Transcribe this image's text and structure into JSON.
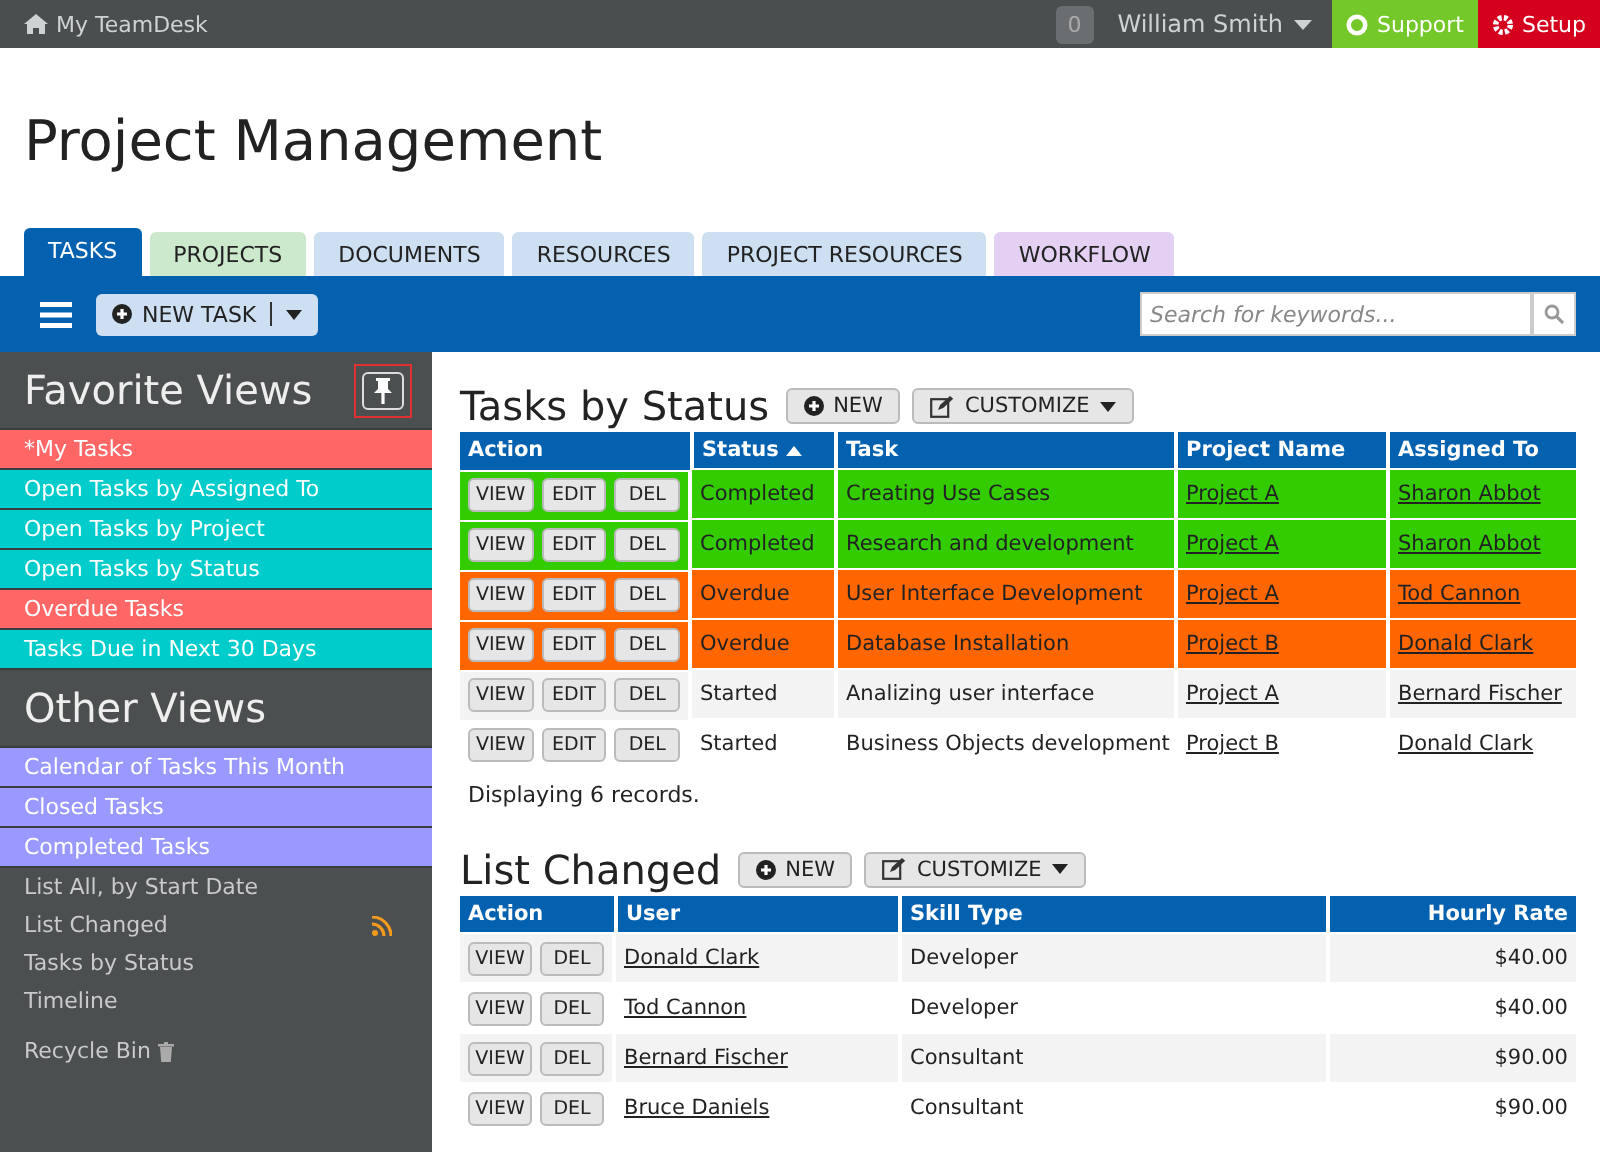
{
  "topbar": {
    "home": "My TeamDesk",
    "count": "0",
    "user": "William Smith",
    "support": "Support",
    "setup": "Setup"
  },
  "page_title": "Project Management",
  "tabs": [
    {
      "label": "TASKS",
      "selected": true,
      "color": "#0461b0"
    },
    {
      "label": "PROJECTS",
      "selected": false,
      "color": "#cde9cd"
    },
    {
      "label": "DOCUMENTS",
      "selected": false,
      "color": "#cddff0"
    },
    {
      "label": "RESOURCES",
      "selected": false,
      "color": "#cddff0"
    },
    {
      "label": "PROJECT RESOURCES",
      "selected": false,
      "color": "#cddff0"
    },
    {
      "label": "WORKFLOW",
      "selected": false,
      "color": "#e3d0f2"
    }
  ],
  "toolbar": {
    "new_task": "NEW TASK",
    "search": {
      "placeholder": "Search for keywords..."
    }
  },
  "sidebar": {
    "favorites_title": "Favorite Views",
    "favorites": [
      {
        "label": "*My Tasks",
        "color": "#ff6666"
      },
      {
        "label": "Open Tasks by Assigned To",
        "color": "#00cccc"
      },
      {
        "label": "Open Tasks by Project",
        "color": "#00cccc"
      },
      {
        "label": "Open Tasks by Status",
        "color": "#00cccc"
      },
      {
        "label": "Overdue Tasks",
        "color": "#ff6666"
      },
      {
        "label": "Tasks Due in Next 30 Days",
        "color": "#00cccc"
      }
    ],
    "other_title": "Other Views",
    "other": [
      {
        "label": "Calendar of Tasks This Month",
        "kind": "highlight",
        "color": "#9999ff"
      },
      {
        "label": "Closed Tasks",
        "kind": "highlight",
        "color": "#9999ff"
      },
      {
        "label": "Completed Tasks",
        "kind": "highlight",
        "color": "#9999ff"
      },
      {
        "label": "List All, by Start Date",
        "kind": "plain"
      },
      {
        "label": "List Changed",
        "kind": "feed"
      },
      {
        "label": "Tasks by Status",
        "kind": "plain"
      },
      {
        "label": "Timeline",
        "kind": "plain"
      }
    ],
    "recycle_bin": "Recycle Bin"
  },
  "sections": [
    {
      "title": "Tasks by Status",
      "new": "NEW",
      "customize": "CUSTOMIZE",
      "action_column": "Action",
      "columns": [
        {
          "label": "Status",
          "kind": "text",
          "sorted": true
        },
        {
          "label": "Task",
          "kind": "text",
          "sorted": false
        },
        {
          "label": "Project Name",
          "kind": "link",
          "sorted": false
        },
        {
          "label": "Assigned To",
          "kind": "link",
          "sorted": false
        }
      ],
      "rows": [
        {
          "color": "#33cc00",
          "actions": [
            "VIEW",
            "EDIT",
            "DEL"
          ],
          "cells": [
            "Completed",
            "Creating Use Cases",
            "Project A",
            "Sharon Abbot"
          ]
        },
        {
          "color": "#33cc00",
          "actions": [
            "VIEW",
            "EDIT",
            "DEL"
          ],
          "cells": [
            "Completed",
            "Research and development",
            "Project A",
            "Sharon Abbot"
          ]
        },
        {
          "color": "#ff6600",
          "actions": [
            "VIEW",
            "EDIT",
            "DEL"
          ],
          "cells": [
            "Overdue",
            "User Interface Development",
            "Project A",
            "Tod Cannon"
          ]
        },
        {
          "color": "#ff6600",
          "actions": [
            "VIEW",
            "EDIT",
            "DEL"
          ],
          "cells": [
            "Overdue",
            "Database Installation",
            "Project B",
            "Donald Clark"
          ]
        },
        {
          "actions": [
            "VIEW",
            "EDIT",
            "DEL"
          ],
          "cells": [
            "Started",
            "Analizing user interface",
            "Project A",
            "Bernard Fischer"
          ]
        },
        {
          "actions": [
            "VIEW",
            "EDIT",
            "DEL"
          ],
          "cells": [
            "Started",
            "Business Objects development",
            "Project B",
            "Donald Clark"
          ]
        }
      ],
      "footer": "Displaying 6 records."
    },
    {
      "title": "List Changed",
      "new": "NEW",
      "customize": "CUSTOMIZE",
      "action_column": "Action",
      "columns": [
        {
          "label": "User",
          "kind": "link",
          "sorted": false
        },
        {
          "label": "Skill Type",
          "kind": "text",
          "sorted": false
        },
        {
          "label": "Hourly Rate",
          "kind": "number",
          "sorted": false
        }
      ],
      "rows": [
        {
          "actions": [
            "VIEW",
            "DEL"
          ],
          "cells": [
            "Donald Clark",
            "Developer",
            "$40.00"
          ]
        },
        {
          "actions": [
            "VIEW",
            "DEL"
          ],
          "cells": [
            "Tod Cannon",
            "Developer",
            "$40.00"
          ]
        },
        {
          "actions": [
            "VIEW",
            "DEL"
          ],
          "cells": [
            "Bernard Fischer",
            "Consultant",
            "$90.00"
          ]
        },
        {
          "actions": [
            "VIEW",
            "DEL"
          ],
          "cells": [
            "Bruce Daniels",
            "Consultant",
            "$90.00"
          ]
        }
      ]
    }
  ]
}
